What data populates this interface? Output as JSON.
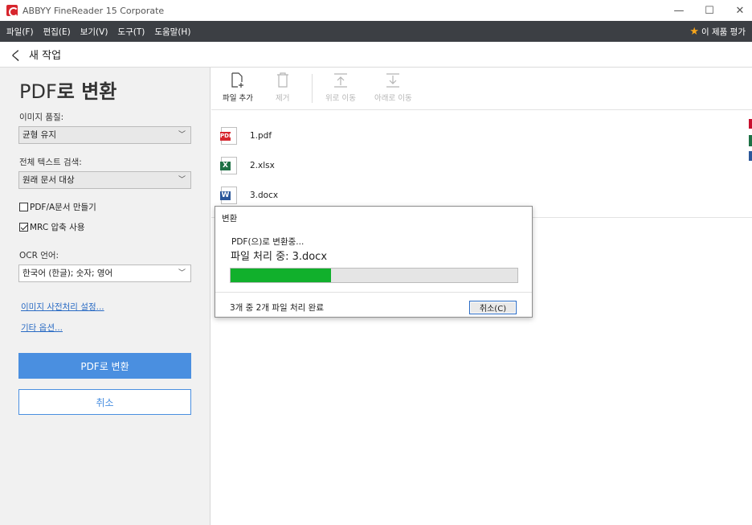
{
  "window": {
    "title": "ABBYY FineReader 15 Corporate",
    "minimize_glyph": "—",
    "maximize_glyph": "☐",
    "close_glyph": "✕"
  },
  "menu": {
    "items": [
      "파일(F)",
      "편집(E)",
      "보기(V)",
      "도구(T)",
      "도움말(H)"
    ],
    "rate_label": "이 제품 평가"
  },
  "nav": {
    "back_glyph": "く",
    "label": "새 작업"
  },
  "left": {
    "title_prefix": "PDF",
    "title_bold": "로 변환",
    "quality_label": "이미지 품질:",
    "quality_value": "균형 유지",
    "fulltext_label": "전체 텍스트 검색:",
    "fulltext_value": "원래 문서 대상",
    "pdfa_label": "PDF/A문서 만들기",
    "pdfa_checked": false,
    "mrc_label": "MRC 압축 사용",
    "mrc_checked": true,
    "ocr_label": "OCR 언어:",
    "ocr_value": "한국어 (한글); 숫자; 영어",
    "preprocess_link": "이미지 사전처리 설정...",
    "options_link": "기타 옵션...",
    "convert_button": "PDF로 변환",
    "cancel_button": "취소"
  },
  "toolbar": {
    "add_file": "파일 추가",
    "remove": "제거",
    "move_up": "위로 이동",
    "move_down": "아래로 이동"
  },
  "files": [
    {
      "name": "1.pdf",
      "type": "pdf",
      "tag": "PDF",
      "color": "#d7262e"
    },
    {
      "name": "2.xlsx",
      "type": "xlsx",
      "tag": "X",
      "color": "#1e7145"
    },
    {
      "name": "3.docx",
      "type": "docx",
      "tag": "W",
      "color": "#2b579a"
    }
  ],
  "dialog": {
    "title": "변환",
    "status": "PDF(으)로 변환중...",
    "current_file": "파일 처리 중: 3.docx",
    "progress_percent": 35,
    "summary": "3개 중 2개 파일 처리 완료",
    "cancel_button": "취소(C)"
  },
  "colors": {
    "accent": "#4a8fe0",
    "menubar": "#3c3f44",
    "progress": "#11b02c",
    "link": "#2a6bc4"
  }
}
